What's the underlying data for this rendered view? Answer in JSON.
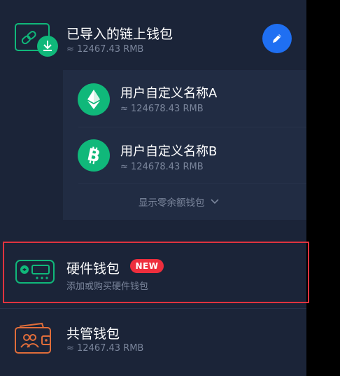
{
  "imported_wallet": {
    "title": "已导入的链上钱包",
    "balance": "≈ 12467.43 RMB",
    "icon": "imported-wallet-icon",
    "edit_icon": "pencil-icon"
  },
  "sub_wallets": [
    {
      "name": "用户自定义名称A",
      "balance": "≈ 124678.43 RMB",
      "coin_icon": "ethereum-icon"
    },
    {
      "name": "用户自定义名称B",
      "balance": "≈ 124678.43 RMB",
      "coin_icon": "bitcoin-icon"
    }
  ],
  "show_zero_balance": {
    "label": "显示零余额钱包",
    "icon": "chevron-down-icon"
  },
  "hardware_wallet": {
    "title": "硬件钱包",
    "badge": "NEW",
    "subtitle": "添加或购买硬件钱包",
    "icon": "hardware-wallet-icon"
  },
  "shared_wallet": {
    "title": "共管钱包",
    "balance": "≈ 12467.43 RMB",
    "icon": "shared-wallet-icon"
  },
  "colors": {
    "background": "#1b2438",
    "card": "#212c43",
    "accent_blue": "#1f6ff2",
    "green": "#10b87a",
    "orange": "#e06d3a",
    "badge_red": "#ee2e3d",
    "highlight_red": "#e0333f"
  }
}
